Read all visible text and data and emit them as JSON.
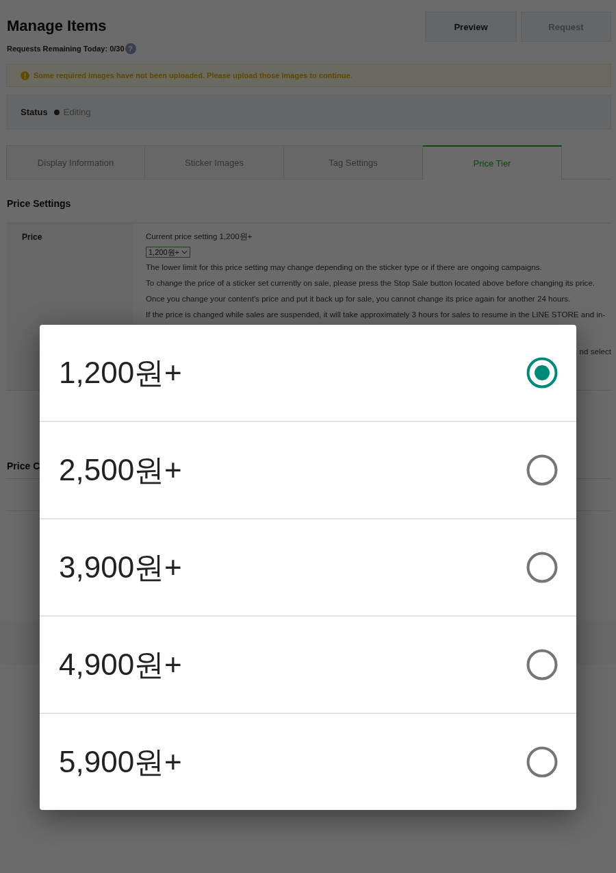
{
  "header": {
    "title": "Manage Items",
    "requests_remaining": "Requests Remaining Today: 0/30",
    "help_icon": "?"
  },
  "preview_button": {
    "label": "Preview",
    "disabled": false
  },
  "request_button": {
    "label": "Request",
    "disabled": true
  },
  "alert": {
    "message": "Some required images have not been uploaded. Please upload those images to continue."
  },
  "status": {
    "label": "Status",
    "value": "Editing"
  },
  "tabs": [
    {
      "label": "Display Information",
      "selected": false
    },
    {
      "label": "Sticker Images",
      "selected": false
    },
    {
      "label": "Tag Settings",
      "selected": false
    },
    {
      "label": "Price Tier",
      "selected": true
    }
  ],
  "price_settings": {
    "title": "Price Settings",
    "price_row": {
      "label": "Price",
      "current_setting": "Current price setting 1,200원+",
      "dropdown": {
        "value": "1,200원+"
      },
      "notes": [
        "The lower limit for this price setting may change depending on the sticker type or if there are ongoing campaigns.",
        "To change the price of a sticker set currently on sale, please press the Stop Sale button located above before changing its price.",
        "Once you change your content's price and put it back up for sale, you cannot change its price again for another 24 hours.",
        "If the price is changed while sales are suspended, it will take approximately 3 hours for sales to resume in the LINE STORE and in-"
      ],
      "note_fragment": "nd select"
    }
  },
  "section_2": {
    "title": "Price C"
  },
  "price_dialog": {
    "options": [
      {
        "label": "1,200원+",
        "selected": true
      },
      {
        "label": "2,500원+",
        "selected": false
      },
      {
        "label": "3,900원+",
        "selected": false
      },
      {
        "label": "4,900원+",
        "selected": false
      },
      {
        "label": "5,900원+",
        "selected": false
      }
    ]
  }
}
